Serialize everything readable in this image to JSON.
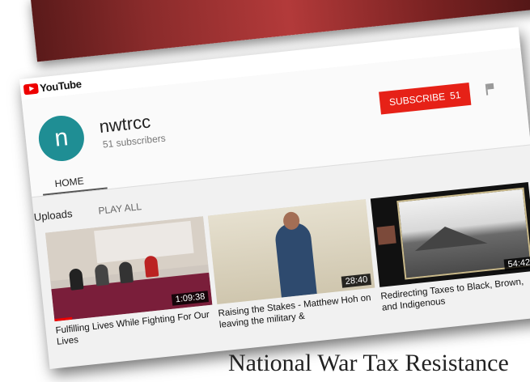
{
  "header": {
    "logo_text": "YouTube"
  },
  "channel": {
    "avatar_letter": "n",
    "name": "nwtrcc",
    "subscribers": "51 subscribers",
    "subscribe_label": "SUBSCRIBE",
    "subscribe_count": "51",
    "tab_home": "HOME"
  },
  "uploads": {
    "title": "Uploads",
    "play_all": "PLAY ALL",
    "videos": [
      {
        "title": "Fulfilling Lives While Fighting For Our Lives",
        "duration": "1:09:38"
      },
      {
        "title": "Raising the Stakes - Matthew Hoh on leaving the military &",
        "duration": "28:40"
      },
      {
        "title": "Redirecting Taxes to Black, Brown, and Indigenous",
        "duration": "54:42"
      }
    ]
  },
  "footer_text": "National War Tax Resistance",
  "colors": {
    "accent": "#e62117",
    "avatar": "#1f8e94"
  }
}
